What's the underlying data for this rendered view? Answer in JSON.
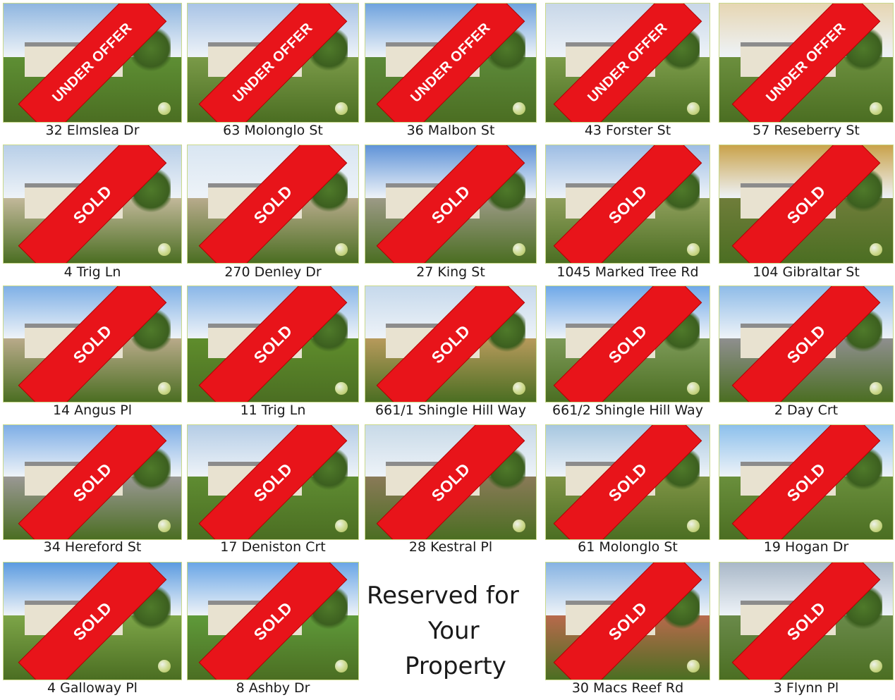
{
  "listings": [
    {
      "address": "32 Elmslea Dr",
      "status": "UNDER OFFER"
    },
    {
      "address": "63 Molonglo St",
      "status": "UNDER OFFER"
    },
    {
      "address": "36 Malbon St",
      "status": "UNDER OFFER"
    },
    {
      "address": "43 Forster St",
      "status": "UNDER OFFER"
    },
    {
      "address": "57 Reseberry St",
      "status": "UNDER OFFER"
    },
    {
      "address": "4 Trig Ln",
      "status": "SOLD"
    },
    {
      "address": "270 Denley Dr",
      "status": "SOLD"
    },
    {
      "address": "27 King St",
      "status": "SOLD"
    },
    {
      "address": "1045 Marked Tree Rd",
      "status": "SOLD"
    },
    {
      "address": "104 Gibraltar St",
      "status": "SOLD"
    },
    {
      "address": "14 Angus Pl",
      "status": "SOLD"
    },
    {
      "address": "11 Trig Ln",
      "status": "SOLD"
    },
    {
      "address": "661/1 Shingle Hill Way",
      "status": "SOLD"
    },
    {
      "address": "661/2 Shingle Hill Way",
      "status": "SOLD"
    },
    {
      "address": "2 Day Crt",
      "status": "SOLD"
    },
    {
      "address": "34 Hereford St",
      "status": "SOLD"
    },
    {
      "address": "17 Deniston Crt",
      "status": "SOLD"
    },
    {
      "address": "28 Kestral Pl",
      "status": "SOLD"
    },
    {
      "address": "61 Molonglo St",
      "status": "SOLD"
    },
    {
      "address": "19 Hogan Dr",
      "status": "SOLD"
    },
    {
      "address": "4 Galloway Pl",
      "status": "SOLD"
    },
    {
      "address": "8 Ashby Dr",
      "status": "SOLD"
    },
    {
      "address": "30 Macs Reef Rd",
      "status": "SOLD"
    },
    {
      "address": "3 Flynn Pl",
      "status": "SOLD"
    }
  ],
  "reserved": {
    "line1": "Reserved for",
    "line2": "Your",
    "line3": "Property"
  },
  "colors": {
    "banner": "#e8141a",
    "photo_border": "#c9d98a"
  }
}
